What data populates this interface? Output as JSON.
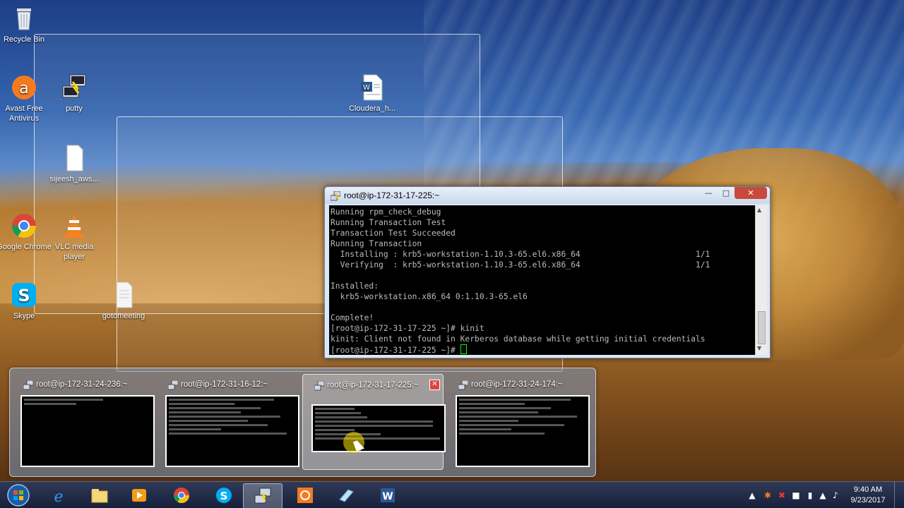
{
  "desktop_icons": [
    {
      "name": "recycle-bin",
      "label": "Recycle Bin"
    },
    {
      "name": "avast",
      "label": "Avast Free Antivirus"
    },
    {
      "name": "putty",
      "label": "putty"
    },
    {
      "name": "cloudera-doc",
      "label": "Cloudera_h..."
    },
    {
      "name": "sijeesh-file",
      "label": "sijeesh_aws..."
    },
    {
      "name": "chrome",
      "label": "Google Chrome"
    },
    {
      "name": "vlc",
      "label": "VLC media player"
    },
    {
      "name": "skype",
      "label": "Skype"
    },
    {
      "name": "gotomeeting",
      "label": "gotomeeting"
    }
  ],
  "putty_window": {
    "title": "root@ip-172-31-17-225:~",
    "lines": [
      "Running rpm_check_debug",
      "Running Transaction Test",
      "Transaction Test Succeeded",
      "Running Transaction",
      "  Installing : krb5-workstation-1.10.3-65.el6.x86_64                        1/1",
      "  Verifying  : krb5-workstation-1.10.3-65.el6.x86_64                        1/1",
      "",
      "Installed:",
      "  krb5-workstation.x86_64 0:1.10.3-65.el6",
      "",
      "Complete!",
      "[root@ip-172-31-17-225 ~]# kinit",
      "kinit: Client not found in Kerberos database while getting initial credentials"
    ],
    "prompt": "[root@ip-172-31-17-225 ~]# "
  },
  "thumbnails": [
    {
      "title": "root@ip-172-31-24-236:~",
      "active": false
    },
    {
      "title": "root@ip-172-31-16-12:~",
      "active": false
    },
    {
      "title": "root@ip-172-31-17-225:~",
      "active": true
    },
    {
      "title": "root@ip-172-31-24-174:~",
      "active": false
    }
  ],
  "taskbar": {
    "apps": [
      "internet-explorer",
      "file-explorer",
      "media-player",
      "chrome",
      "skype",
      "putty",
      "avast",
      "notepad",
      "word"
    ],
    "active_app": "putty"
  },
  "clock": {
    "time": "9:40 AM",
    "date": "9/23/2017"
  }
}
